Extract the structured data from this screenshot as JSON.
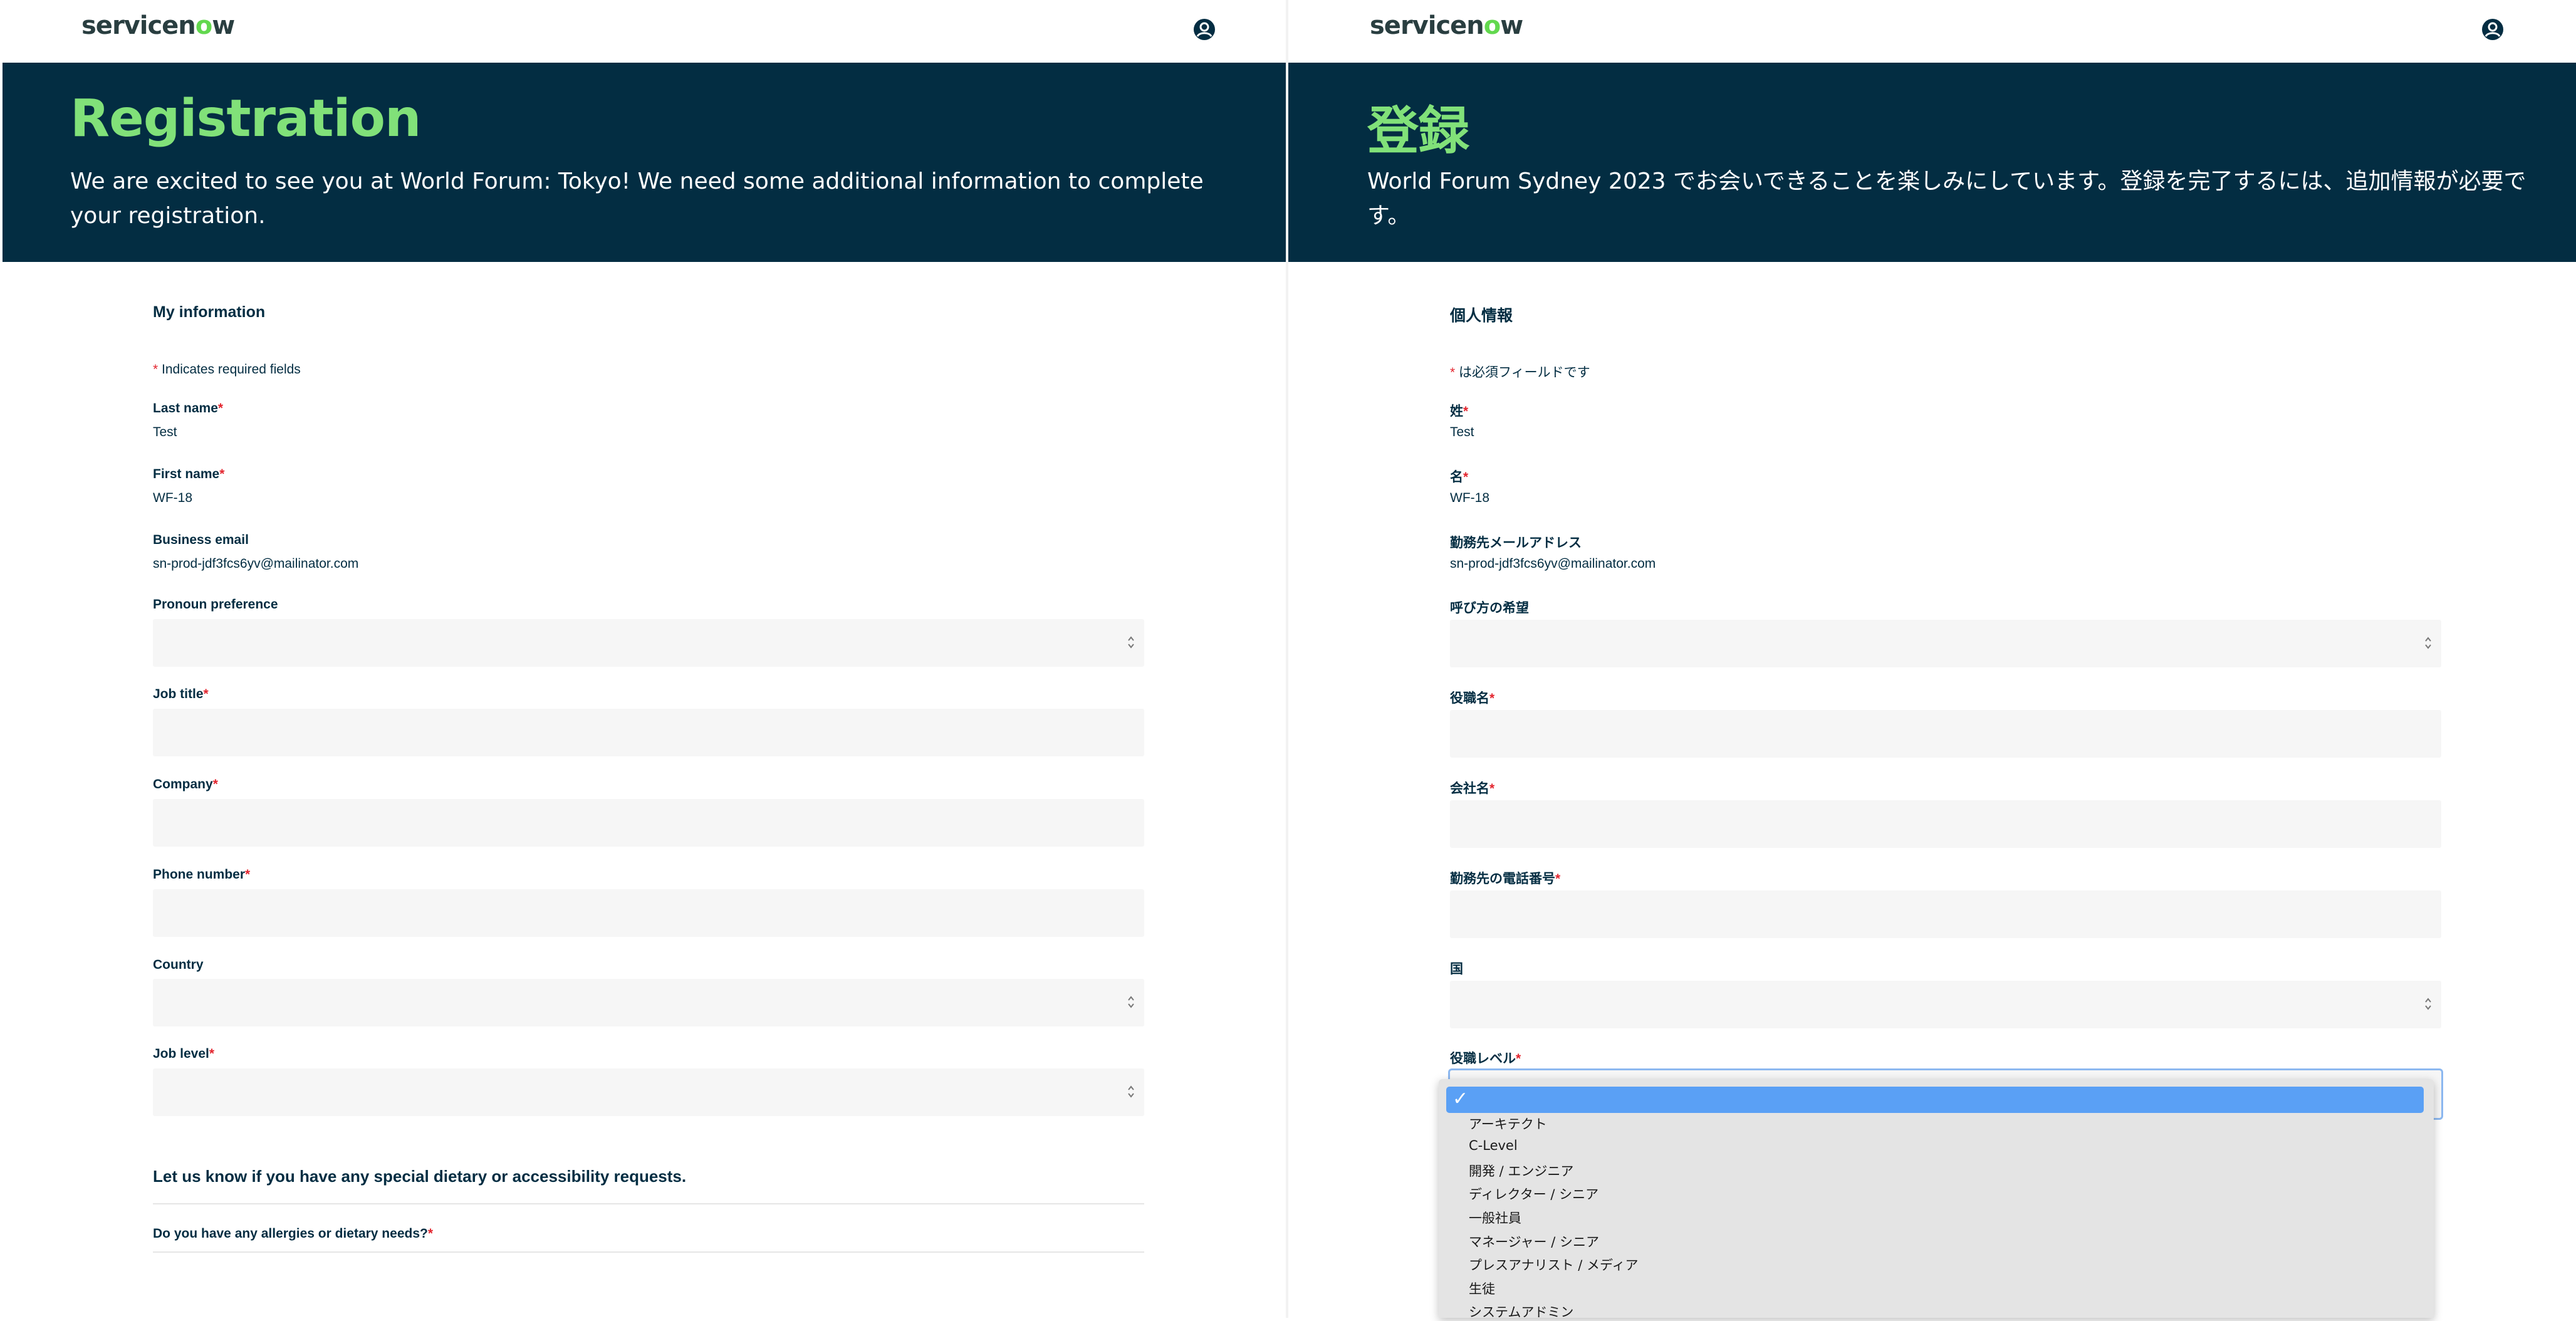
{
  "brand": {
    "logo_prefix": "servicen",
    "logo_o": "o",
    "logo_suffix": "w"
  },
  "left": {
    "hero": {
      "title": "Registration",
      "text": "We are excited to see you at World Forum: Tokyo! We need some additional information to complete your registration."
    },
    "form": {
      "section_title": "My information",
      "required_note": "Indicates required fields",
      "last_name": {
        "label": "Last name",
        "value": "Test"
      },
      "first_name": {
        "label": "First name",
        "value": "WF-18"
      },
      "business_email": {
        "label": "Business email",
        "value": "sn-prod-jdf3fcs6yv@mailinator.com"
      },
      "pronoun": {
        "label": "Pronoun preference",
        "value": ""
      },
      "job_title": {
        "label": "Job title",
        "value": ""
      },
      "company": {
        "label": "Company",
        "value": ""
      },
      "phone": {
        "label": "Phone number",
        "value": ""
      },
      "country": {
        "label": "Country",
        "value": ""
      },
      "job_level": {
        "label": "Job level",
        "value": ""
      },
      "dietary_heading": "Let us know if you have any special dietary or accessibility requests.",
      "allergies_label": "Do you have any allergies or dietary needs?"
    }
  },
  "right": {
    "hero": {
      "title": "登録",
      "text": "World Forum Sydney 2023 でお会いできることを楽しみにしています。登録を完了するには、追加情報が必要です。"
    },
    "form": {
      "section_title": "個人情報",
      "required_note": "は必須フィールドです",
      "last_name": {
        "label": "姓",
        "value": "Test"
      },
      "first_name": {
        "label": "名",
        "value": "WF-18"
      },
      "business_email": {
        "label": "勤務先メールアドレス",
        "value": "sn-prod-jdf3fcs6yv@mailinator.com"
      },
      "pronoun": {
        "label": "呼び方の希望",
        "value": ""
      },
      "job_title": {
        "label": "役職名",
        "value": ""
      },
      "company": {
        "label": "会社名",
        "value": ""
      },
      "phone": {
        "label": "勤務先の電話番号",
        "value": ""
      },
      "country": {
        "label": "国",
        "value": ""
      },
      "job_level": {
        "label": "役職レベル",
        "value": ""
      }
    },
    "job_level_dropdown": {
      "selected_mark": "✓",
      "options": [
        "アーキテクト",
        "C-Level",
        "開発 / エンジニア",
        "ディレクター / シニア",
        "一般社員",
        "マネージャー / シニア",
        "プレスアナリスト / メディア",
        "生徒",
        "システムアドミン"
      ]
    }
  },
  "colors": {
    "hero_bg": "#032d42",
    "hero_title": "#81e179",
    "required_star": "#e3262f",
    "input_bg": "#f6f6f6",
    "dropdown_highlight": "#5aa0f5"
  }
}
